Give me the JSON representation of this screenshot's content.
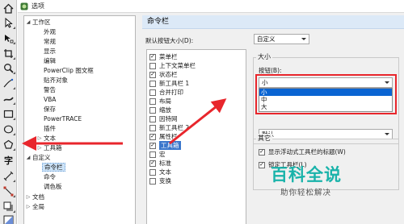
{
  "dialog": {
    "title": "选项"
  },
  "tree": {
    "items": [
      {
        "label": "工作区",
        "expanded": true
      },
      {
        "label": "外观"
      },
      {
        "label": "常规"
      },
      {
        "label": "显示"
      },
      {
        "label": "编辑"
      },
      {
        "label": "PowerClip 图文框"
      },
      {
        "label": "贴齐对象"
      },
      {
        "label": "警告"
      },
      {
        "label": "VBA"
      },
      {
        "label": "保存"
      },
      {
        "label": "PowerTRACE"
      },
      {
        "label": "插件"
      },
      {
        "label": "文本",
        "expanded": false
      },
      {
        "label": "工具箱",
        "expanded": false
      },
      {
        "label": "自定义",
        "expanded": true
      },
      {
        "label": "命令栏",
        "selected": true
      },
      {
        "label": "命令"
      },
      {
        "label": "调色板"
      },
      {
        "label": "文档",
        "expanded": false
      },
      {
        "label": "全局",
        "expanded": false
      }
    ]
  },
  "panel": {
    "title": "命令栏",
    "default_size_label": "默认按钮大小(D):",
    "default_size_value": "自定义",
    "toolbars": [
      {
        "label": "菜单栏",
        "checked": true
      },
      {
        "label": "上下文菜单栏",
        "checked": false
      },
      {
        "label": "状态栏",
        "checked": true
      },
      {
        "label": "新工具栏 1",
        "checked": false
      },
      {
        "label": "合并打印",
        "checked": false
      },
      {
        "label": "布局",
        "checked": false
      },
      {
        "label": "缩放",
        "checked": false
      },
      {
        "label": "因特网",
        "checked": false
      },
      {
        "label": "新工具栏 2",
        "checked": false
      },
      {
        "label": "属性栏",
        "checked": true
      },
      {
        "label": "工具箱",
        "checked": true,
        "selected": true
      },
      {
        "label": "宏",
        "checked": false
      },
      {
        "label": "标准",
        "checked": true
      },
      {
        "label": "文本",
        "checked": false
      },
      {
        "label": "变换",
        "checked": false
      }
    ],
    "size_group": {
      "title": "大小",
      "button_label": "按钮(B):",
      "button_value": "小",
      "options": [
        "小",
        "中",
        "大"
      ],
      "selected_option": "小",
      "lower_combo_value": "默认"
    },
    "other_group": {
      "title": "其它",
      "show_floating_title": {
        "label": "显示浮动式工具栏的标题(W)",
        "checked": true
      },
      "lock_toolbars": {
        "label": "锁定工具栏(L)",
        "checked": true
      }
    }
  },
  "toolbox": {
    "tools": [
      "home-icon",
      "pick-tool-icon",
      "shape-tool-icon",
      "crop-tool-icon",
      "zoom-tool-icon",
      "freehand-tool-icon",
      "artistic-media-icon",
      "rectangle-tool-icon",
      "ellipse-tool-icon",
      "polygon-tool-icon",
      "text-tool-icon",
      "parallel-dimension-icon",
      "connector-tool-icon",
      "drop-shadow-icon",
      "transparency-icon"
    ],
    "text_tool_glyph": "字"
  },
  "watermark": {
    "logo_text": "百科全说",
    "sub_text": "助你轻松解决"
  },
  "colors": {
    "highlight_red": "#e8262c",
    "selection_blue": "#0a64d2",
    "panel_header": "#dce9f7",
    "watermark_teal": "#19b3aa"
  }
}
